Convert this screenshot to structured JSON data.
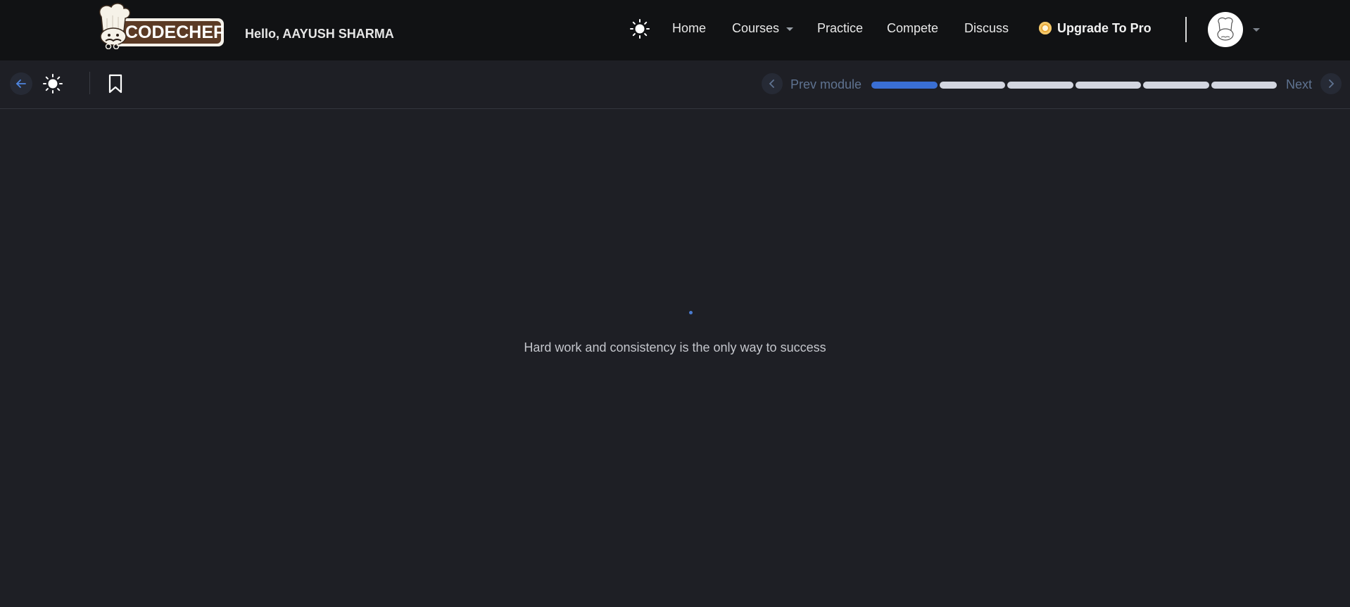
{
  "header": {
    "logo_text": "CODECHEF",
    "greeting": "Hello, AAYUSH SHARMA",
    "theme_icon": "sun-icon",
    "nav": {
      "home": "Home",
      "courses": "Courses",
      "practice": "Practice",
      "compete": "Compete",
      "discuss": "Discuss"
    },
    "upgrade_label": "Upgrade To Pro",
    "avatar_icon": "chef-avatar-icon"
  },
  "toolbar": {
    "back_icon": "arrow-left-icon",
    "theme_icon": "sun-icon",
    "bookmark_icon": "bookmark-icon",
    "prev_label": "Prev module",
    "next_label": "Next",
    "progress": {
      "total_segments": 6,
      "active_segment": 1
    }
  },
  "main": {
    "quote": "Hard work and consistency is the only way to success"
  },
  "colors": {
    "background": "#1e1f25",
    "header_background": "#111214",
    "accent": "#3a6fd4",
    "muted_blue": "#5f7391"
  }
}
